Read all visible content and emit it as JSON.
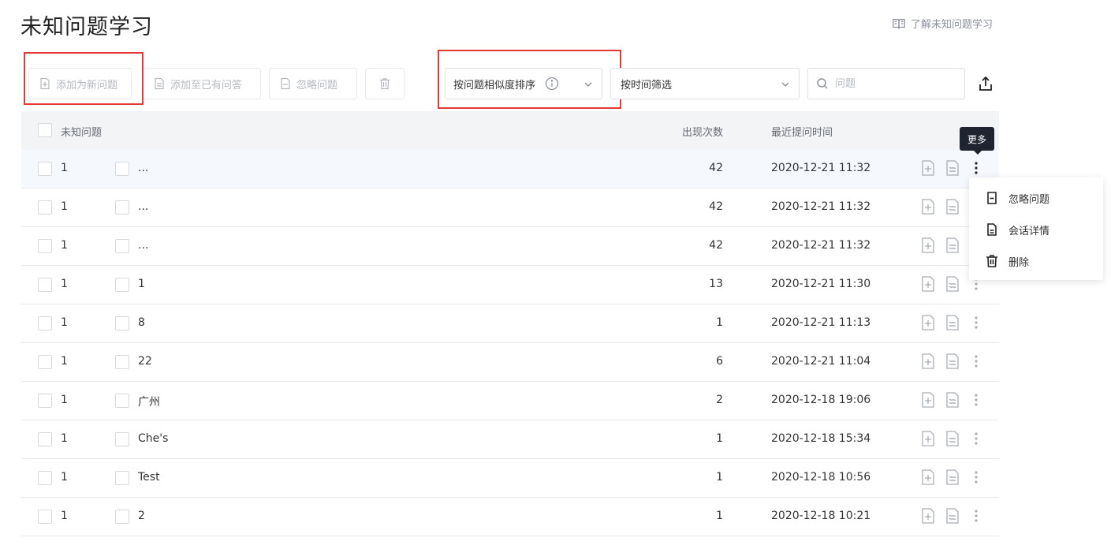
{
  "page": {
    "title": "未知问题学习",
    "learn_link": "了解未知问题学习"
  },
  "toolbar": {
    "add_new": "添加为新问题",
    "add_existing": "添加至已有问答",
    "ignore": "忽略问题",
    "sort_select": "按问题相似度排序",
    "time_filter": "按时间筛选",
    "search_placeholder": "问题"
  },
  "table": {
    "headers": {
      "question": "未知问题",
      "count": "出现次数",
      "time": "最近提问时间"
    },
    "rows": [
      {
        "idx": "1",
        "question": "...",
        "count": "42",
        "time": "2020-12-21 11:32"
      },
      {
        "idx": "1",
        "question": "...",
        "count": "42",
        "time": "2020-12-21 11:32"
      },
      {
        "idx": "1",
        "question": "...",
        "count": "42",
        "time": "2020-12-21 11:32"
      },
      {
        "idx": "1",
        "question": "1",
        "count": "13",
        "time": "2020-12-21 11:30"
      },
      {
        "idx": "1",
        "question": "8",
        "count": "1",
        "time": "2020-12-21 11:13"
      },
      {
        "idx": "1",
        "question": "22",
        "count": "6",
        "time": "2020-12-21 11:04"
      },
      {
        "idx": "1",
        "question": "广州",
        "count": "2",
        "time": "2020-12-18 19:06"
      },
      {
        "idx": "1",
        "question": "Che's",
        "count": "1",
        "time": "2020-12-18 15:34"
      },
      {
        "idx": "1",
        "question": "Test",
        "count": "1",
        "time": "2020-12-18 10:56"
      },
      {
        "idx": "1",
        "question": "2",
        "count": "1",
        "time": "2020-12-18 10:21"
      }
    ]
  },
  "tooltip": {
    "text": "更多"
  },
  "menu": {
    "items": [
      {
        "label": "忽略问题",
        "icon": "minus-file-icon"
      },
      {
        "label": "会话详情",
        "icon": "document-lines-icon"
      },
      {
        "label": "删除",
        "icon": "trash-icon"
      }
    ]
  },
  "colors": {
    "highlight_box": "#e53935",
    "tooltip_bg": "#1f2430",
    "header_bg": "#f3f4f6"
  }
}
